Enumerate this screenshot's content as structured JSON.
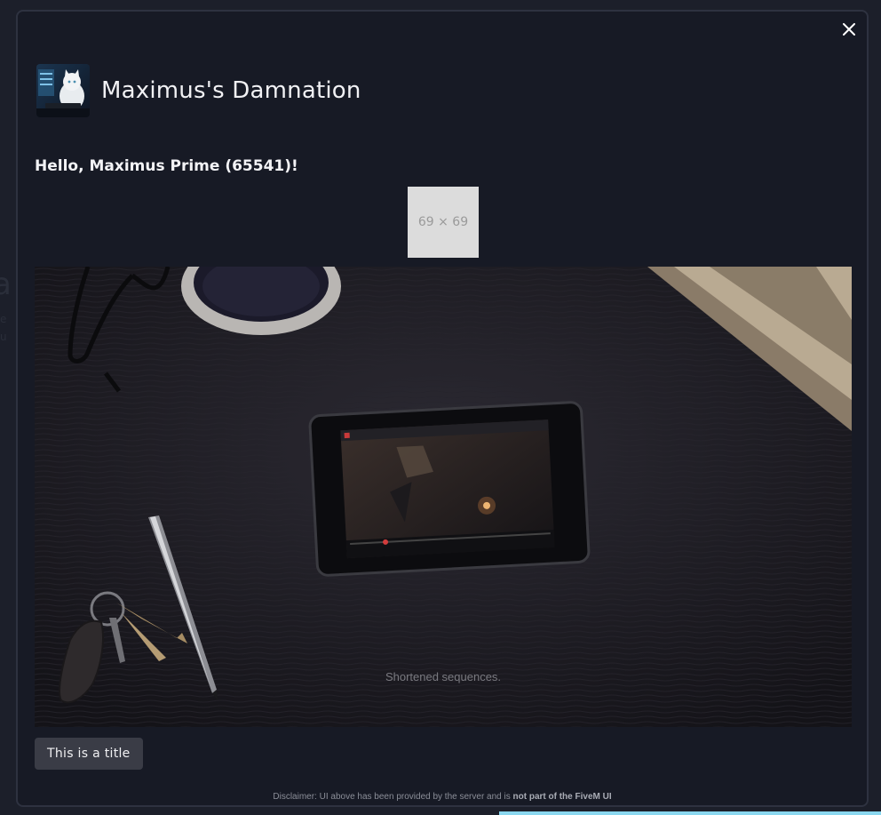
{
  "modal": {
    "server_name": "Maximus's Damnation",
    "greeting": "Hello, Maximus Prime (65541)!",
    "placeholder_label": "69 × 69",
    "video": {
      "subtitle": "Shortened sequences."
    },
    "title_button_label": "This is a title",
    "disclaimer_prefix": "Disclaimer: UI above has been provided by the server and is ",
    "disclaimer_bold": "not part of the FiveM UI"
  },
  "icons": {
    "close": "close-icon",
    "avatar": "avatar-image"
  },
  "colors": {
    "modal_bg": "#171a25",
    "accent": "#8ad7ef",
    "button_bg": "#3a3c46"
  }
}
